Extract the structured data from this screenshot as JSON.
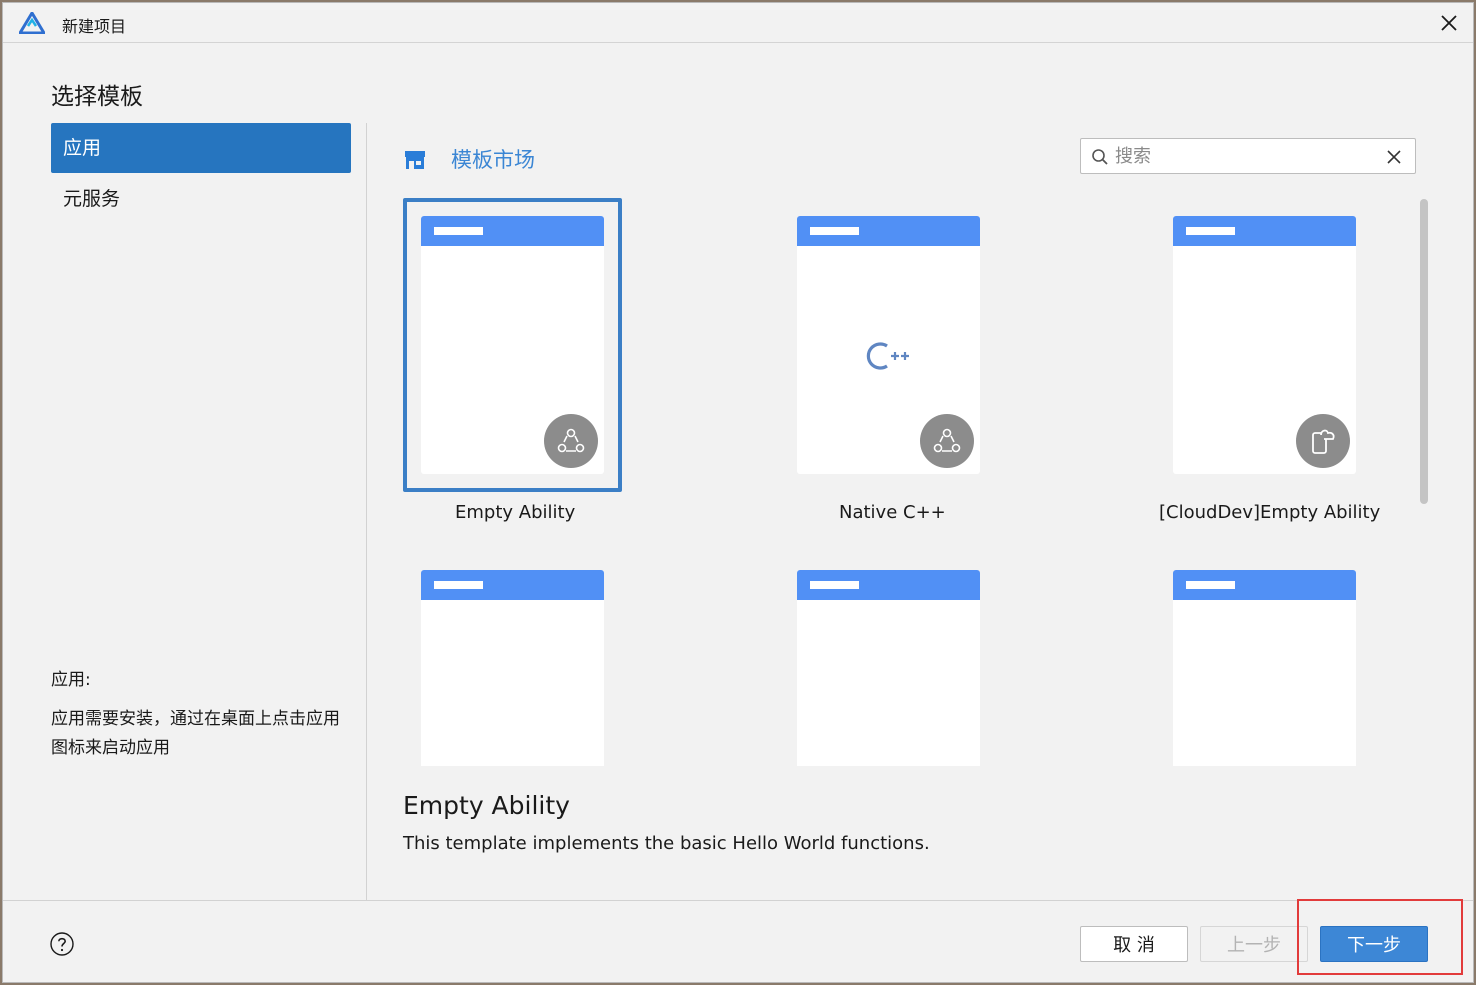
{
  "window": {
    "title": "新建项目"
  },
  "left_panel": {
    "section_title": "选择模板",
    "nav_items": [
      {
        "label": "应用",
        "active": true
      },
      {
        "label": "元服务",
        "active": false
      }
    ],
    "description_title": "应用:",
    "description_body": "应用需要安装，通过在桌面上点击应用图标来启动应用"
  },
  "right_panel": {
    "market_link": "模板市场",
    "search": {
      "placeholder": "搜索",
      "value": ""
    },
    "templates": [
      {
        "label": "Empty Ability",
        "badge": "ability-icon",
        "selected": true
      },
      {
        "label": "Native C++",
        "badge": "ability-icon",
        "selected": false
      },
      {
        "label": "[CloudDev]Empty Ability",
        "badge": "cloud-device-icon",
        "selected": false
      },
      {
        "label": "",
        "badge": "",
        "selected": false
      },
      {
        "label": "",
        "badge": "",
        "selected": false
      },
      {
        "label": "",
        "badge": "",
        "selected": false
      }
    ],
    "detail": {
      "title": "Empty Ability",
      "body": "This template implements the basic Hello World functions."
    }
  },
  "footer": {
    "cancel_label": "取 消",
    "prev_label": "上一步",
    "next_label": "下一步"
  },
  "colors": {
    "accent": "#2675bf",
    "phone_bar": "#5190f5",
    "highlight": "#e23b3b",
    "link": "#3b86d4"
  }
}
